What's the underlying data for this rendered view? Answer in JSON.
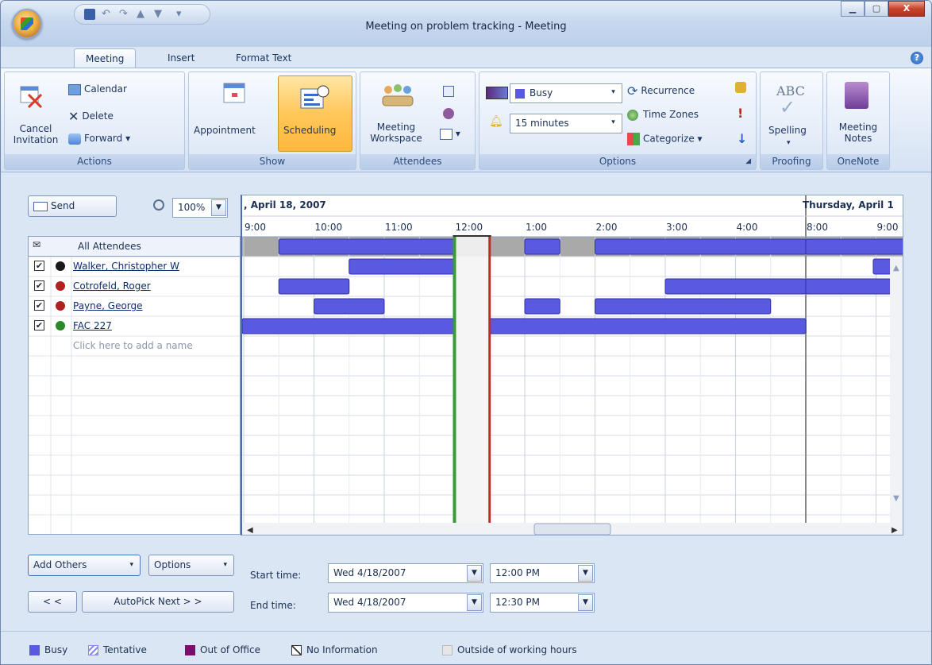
{
  "window": {
    "title": "Meeting on problem tracking - Meeting",
    "controls": [
      "minimize",
      "maximize",
      "close"
    ]
  },
  "tabs": [
    {
      "label": "Meeting",
      "active": true
    },
    {
      "label": "Insert",
      "active": false
    },
    {
      "label": "Format Text",
      "active": false
    }
  ],
  "ribbon": {
    "actions": {
      "label": "Actions",
      "cancel_line1": "Cancel",
      "cancel_line2": "Invitation",
      "calendar": "Calendar",
      "delete": "Delete",
      "forward": "Forward"
    },
    "show": {
      "label": "Show",
      "appointment": "Appointment",
      "scheduling": "Scheduling"
    },
    "attendees": {
      "label": "Attendees",
      "workspace_line1": "Meeting",
      "workspace_line2": "Workspace"
    },
    "options": {
      "label": "Options",
      "show_as": "Busy",
      "reminder": "15 minutes",
      "recurrence": "Recurrence",
      "time_zones": "Time Zones",
      "categorize": "Categorize"
    },
    "proofing": {
      "label": "Proofing",
      "spelling": "Spelling",
      "icon_text": "ABC"
    },
    "onenote": {
      "label": "OneNote",
      "notes_line1": "Meeting",
      "notes_line2": "Notes"
    }
  },
  "toolbar": {
    "send": "Send",
    "zoom": "100%"
  },
  "attendees": {
    "header": "All Attendees",
    "add_placeholder": "Click here to add a name",
    "list": [
      {
        "name": "Walker, Christopher W",
        "checked": true,
        "role": "organizer"
      },
      {
        "name": "Cotrofeld, Roger",
        "checked": true,
        "role": "required"
      },
      {
        "name": "Payne, George",
        "checked": true,
        "role": "required"
      },
      {
        "name": "FAC 227",
        "checked": true,
        "role": "resource"
      }
    ]
  },
  "schedule": {
    "day1": ", April 18, 2007",
    "day2": "Thursday, April 1",
    "times": [
      "9:00",
      "10:00",
      "11:00",
      "12:00",
      "1:00",
      "2:00",
      "3:00",
      "4:00",
      "8:00",
      "9:00"
    ],
    "busy": {
      "all": [
        [
          0.5,
          3
        ],
        [
          4,
          4.5
        ],
        [
          5,
          8
        ],
        [
          8,
          12
        ]
      ],
      "walker": [
        [
          1.5,
          3
        ],
        [
          8.96,
          12
        ]
      ],
      "cotrofeld": [
        [
          0.5,
          1.5
        ],
        [
          6,
          8
        ],
        [
          8,
          12
        ]
      ],
      "payne": [
        [
          1,
          2
        ],
        [
          4,
          4.5
        ],
        [
          5,
          7.5
        ]
      ],
      "fac": [
        [
          -0.1,
          3
        ],
        [
          3.5,
          8
        ]
      ]
    },
    "selection": {
      "start": 3,
      "end": 3.5
    }
  },
  "controls": {
    "add_others": "Add Others",
    "options": "Options",
    "prev": "< <",
    "autopick": "AutoPick Next > >",
    "start_label": "Start time:",
    "end_label": "End time:",
    "start_date": "Wed 4/18/2007",
    "start_time": "12:00 PM",
    "end_date": "Wed 4/18/2007",
    "end_time": "12:30 PM"
  },
  "legend": {
    "busy": "Busy",
    "tentative": "Tentative",
    "out_of_office": "Out of Office",
    "no_info": "No Information",
    "outside": "Outside of working hours",
    "busy_color": "#5a5ae0",
    "ooo_color": "#7a0f6e"
  }
}
